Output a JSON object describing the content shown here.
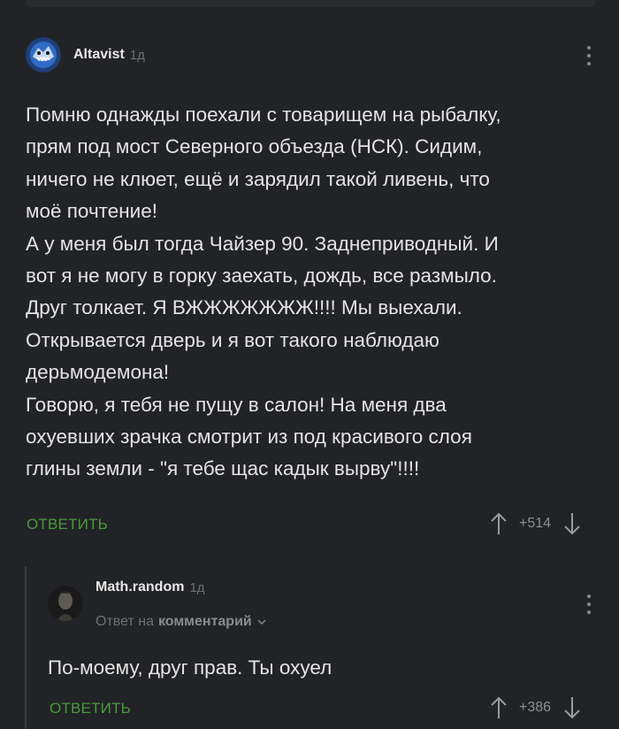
{
  "comments": [
    {
      "author": "Altavist",
      "time": "1д",
      "avatar_icon": "shark-avatar",
      "text": "Помню однажды поехали с товарищем на рыбалку,\nпрям под мост Северного объезда (НСК). Сидим,\nничего не клюет, ещё и зарядил такой ливень, что\nмоё почтение!\nА у меня был тогда Чайзер 90. Заднеприводный. И\nвот я не могу в горку заехать, дождь, все размыло.\nДруг толкает. Я ВЖЖЖЖЖЖЖ!!!! Мы выехали.\nОткрывается дверь и я вот такого наблюдаю\nдерьмодемона!\nГоворю, я тебя не пущу в салон! На меня два\nохуевших зрачка смотрит из под красивого слоя\nглины земли - \"я тебе щас кадык вырву\"!!!!",
      "reply_label": "ОТВЕТИТЬ",
      "score": "+514"
    },
    {
      "author": "Math.random",
      "time": "1д",
      "avatar_icon": "dark-portrait-avatar",
      "reply_to_prefix": "Ответ на",
      "reply_to_target": "комментарий",
      "text": "По-моему, друг прав. Ты охуел",
      "reply_label": "ОТВЕТИТЬ",
      "score": "+386"
    }
  ],
  "colors": {
    "background": "#222326",
    "accent_green": "#4b9a3f",
    "muted": "#6f7075"
  }
}
